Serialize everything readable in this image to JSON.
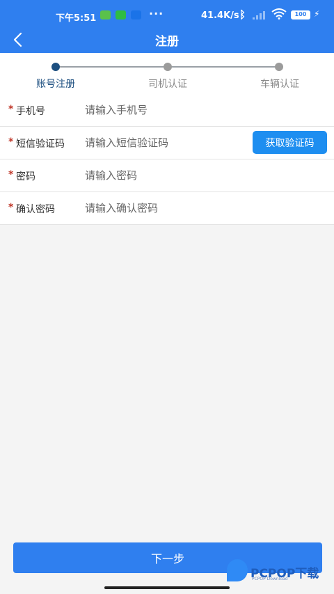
{
  "status_bar": {
    "time": "下午5:51",
    "network_speed": "41.4K/s",
    "battery": "100",
    "more_dots": "···",
    "app_badges": [
      "wechat-badge",
      "message-badge",
      "zhihu-badge"
    ]
  },
  "header": {
    "title": "注册",
    "back_icon": "chevron-left-icon"
  },
  "steps": [
    {
      "label": "账号注册",
      "active": true
    },
    {
      "label": "司机认证",
      "active": false
    },
    {
      "label": "车辆认证",
      "active": false
    }
  ],
  "form": {
    "required_mark": "*",
    "phone": {
      "label": "手机号",
      "placeholder": "请输入手机号",
      "value": ""
    },
    "sms_code": {
      "label": "短信验证码",
      "placeholder": "请输入短信验证码",
      "value": "",
      "button_label": "获取验证码"
    },
    "password": {
      "label": "密码",
      "placeholder": "请输入密码",
      "value": ""
    },
    "confirm_password": {
      "label": "确认密码",
      "placeholder": "请输入确认密码",
      "value": ""
    }
  },
  "footer": {
    "next_button": "下一步"
  },
  "watermark": {
    "brand": "PCPOP下载",
    "sub": "PCPOP Download"
  },
  "colors": {
    "primary": "#2f7fef",
    "step_active": "#1d4f80",
    "required": "#c0392b",
    "code_button": "#1e8ef0"
  }
}
